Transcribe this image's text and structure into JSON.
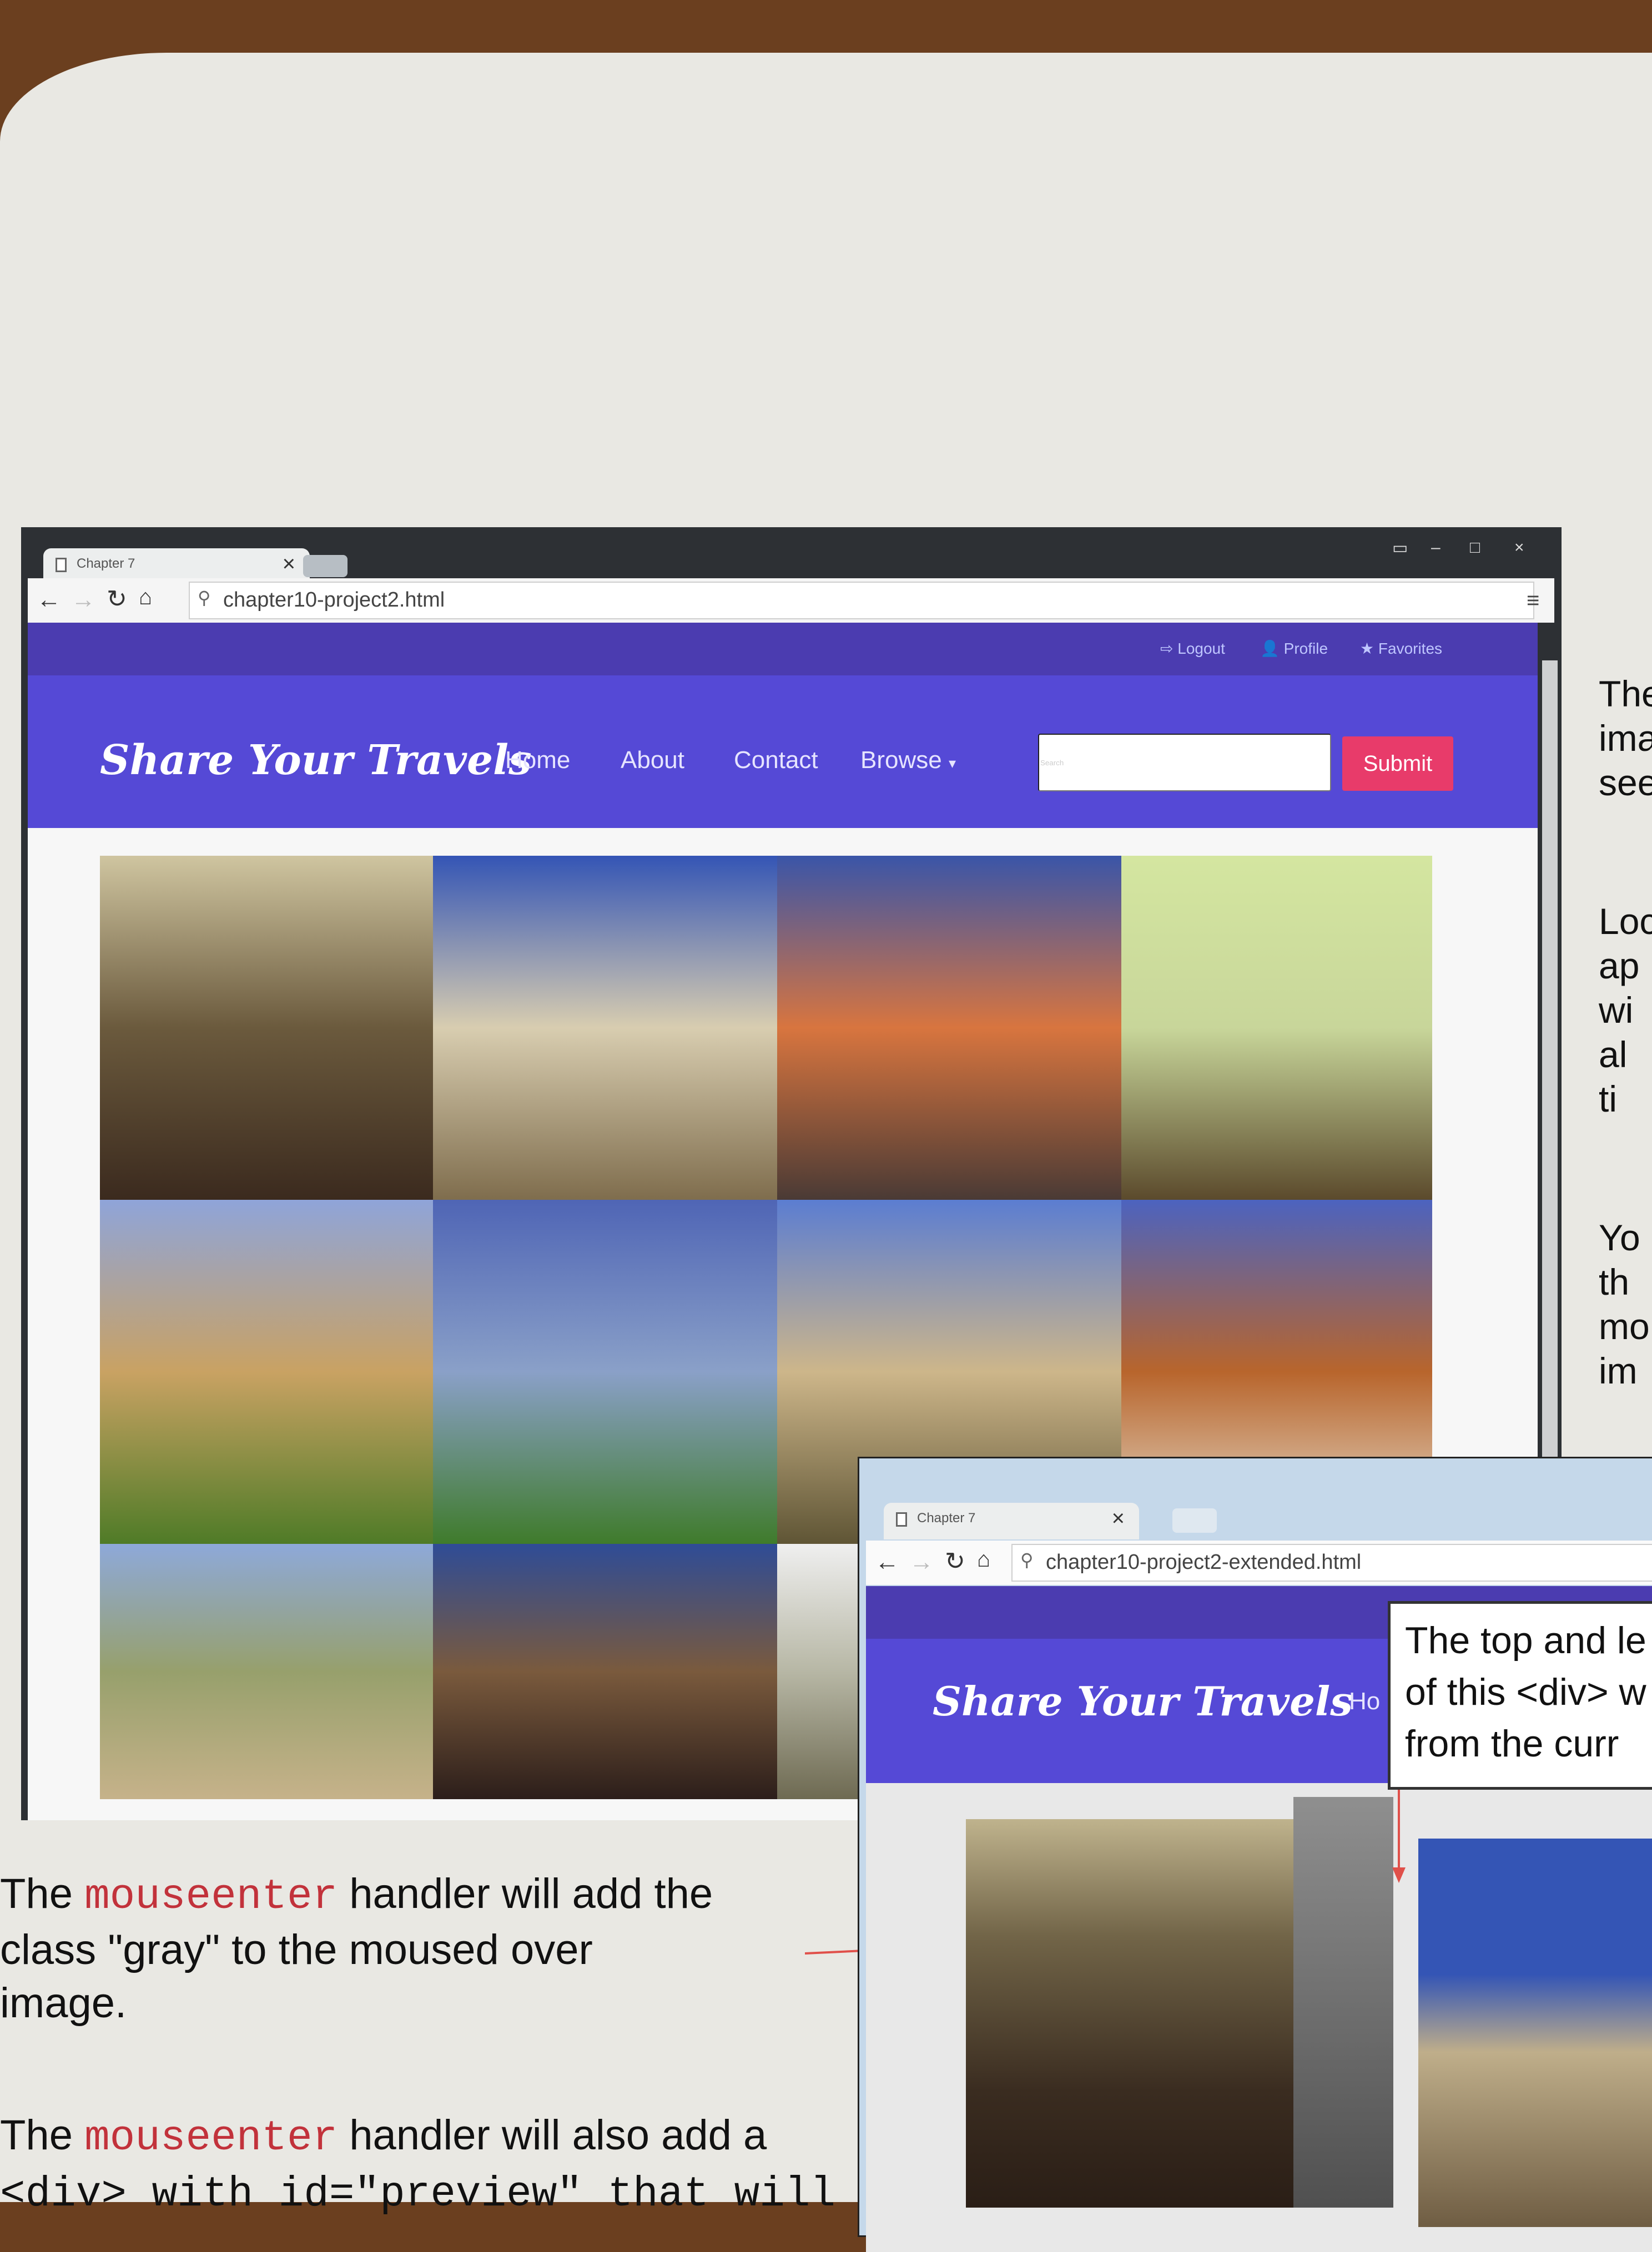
{
  "browser1": {
    "tab_title": "Chapter 7",
    "url": "chapter10-project2.html",
    "site": {
      "top_links": [
        "Logout",
        "Profile",
        "Favorites"
      ],
      "brand": "Share Your Travels",
      "nav": [
        "Home",
        "About",
        "Contact",
        "Browse"
      ],
      "search_placeholder": "Search",
      "submit_label": "Submit"
    },
    "photos": [
      {
        "name": "river-town-photo",
        "colors": [
          "#cfc5a0",
          "#6b5a3d",
          "#3b2a1e"
        ]
      },
      {
        "name": "triumphal-arch-photo",
        "colors": [
          "#3455b5",
          "#d8cdb0",
          "#7f6d4d"
        ]
      },
      {
        "name": "harbour-houses-photo",
        "colors": [
          "#3a55a8",
          "#d8753f",
          "#4a3a35"
        ]
      },
      {
        "name": "museum-dome-photo",
        "colors": [
          "#d4e6a0",
          "#c8d69a",
          "#5b4a2c"
        ]
      },
      {
        "name": "greek-temple-photo",
        "colors": [
          "#8fa4d9",
          "#c9a263",
          "#4f7b27"
        ]
      },
      {
        "name": "mountain-forest-photo",
        "colors": [
          "#4f65b5",
          "#8aa0c8",
          "#3f7b2b"
        ]
      },
      {
        "name": "church-square-photo",
        "colors": [
          "#5b7dd1",
          "#cdb68a",
          "#5f5535"
        ]
      },
      {
        "name": "cathedral-dome-photo",
        "colors": [
          "#4c63bf",
          "#b8652c",
          "#e7e4d6"
        ]
      },
      {
        "name": "ruins-landscape-photo",
        "colors": [
          "#8ea9d9",
          "#97a06c",
          "#c6b28a"
        ]
      },
      {
        "name": "desert-hill-photo",
        "colors": [
          "#2f4c96",
          "#7a5a3d",
          "#2c1e1a"
        ]
      },
      {
        "name": "partial-photo",
        "colors": [
          "#efefef",
          "#b7b7a5",
          "#6e6a52"
        ]
      }
    ]
  },
  "browser2": {
    "tab_title": "Chapter 7",
    "url": "chapter10-project2-extended.html",
    "brand": "Share Your Travels",
    "nav_partial": "Ho",
    "callout_text": "The top and le\nof this <div> w\nfrom the curr"
  },
  "side_text": {
    "p1": "The\nima\nsee",
    "p2": "Loc\nap\nwi\nal\nti",
    "p3": "Yo\nth\nmo\nim"
  },
  "body_text": {
    "p1_pre": "The ",
    "p1_code": "mouseenter",
    "p1_post": " handler will add the",
    "p1_line2": "class \"gray\" to the moused over",
    "p1_line3": "image.",
    "p2_pre": "The ",
    "p2_code": "mouseenter",
    "p2_post": " handler will also add a",
    "p2_line2": "<div> with id=\"preview\" that will"
  }
}
